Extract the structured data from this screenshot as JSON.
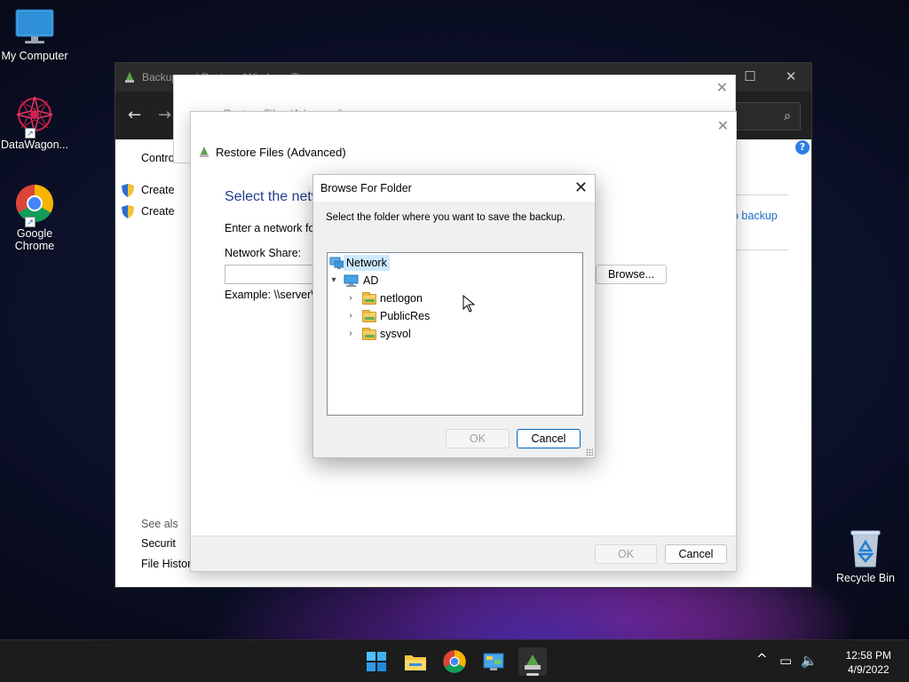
{
  "desktop": {
    "icons": [
      {
        "label": "My Computer"
      },
      {
        "label": "DataWagon..."
      },
      {
        "label": "Google Chrome"
      },
      {
        "label": "Recycle Bin"
      }
    ]
  },
  "main_window": {
    "title": "Backup and Restore (Windows 7)",
    "side_links": [
      "Contro",
      "Create",
      "Create"
    ],
    "see_also_heading": "See als",
    "see_also_links": [
      "Securit",
      "File History"
    ],
    "right_link": "p backup",
    "help_glyph": "?"
  },
  "back_dialog": {
    "title": "Restore Files (Advanced)"
  },
  "restore_dialog": {
    "title": "Restore Files (Advanced)",
    "heading": "Select the netw",
    "instruction": "Enter a network fol",
    "share_label": "Network Share:",
    "example": "Example: \\\\server\\s",
    "browse_label": "Browse...",
    "ok_label": "OK",
    "cancel_label": "Cancel"
  },
  "browse_dialog": {
    "title": "Browse For Folder",
    "prompt": "Select the folder where you want to save the backup.",
    "tree": [
      {
        "label": "Network",
        "level": 0,
        "selected": true
      },
      {
        "label": "AD",
        "level": 1,
        "expanded": true
      },
      {
        "label": "netlogon",
        "level": 2
      },
      {
        "label": "PublicRes",
        "level": 2
      },
      {
        "label": "sysvol",
        "level": 2
      }
    ],
    "ok_label": "OK",
    "cancel_label": "Cancel"
  },
  "taskbar": {
    "apps": [
      "start-icon",
      "file-explorer-icon",
      "chrome-icon",
      "control-panel-icon",
      "backup-restore-icon"
    ],
    "time": "12:58 PM",
    "date": "4/9/2022"
  },
  "colors": {
    "accent": "#0067c0",
    "link": "#1a6fc4",
    "heading": "#1e3f8c",
    "selection": "#cce8ff"
  }
}
